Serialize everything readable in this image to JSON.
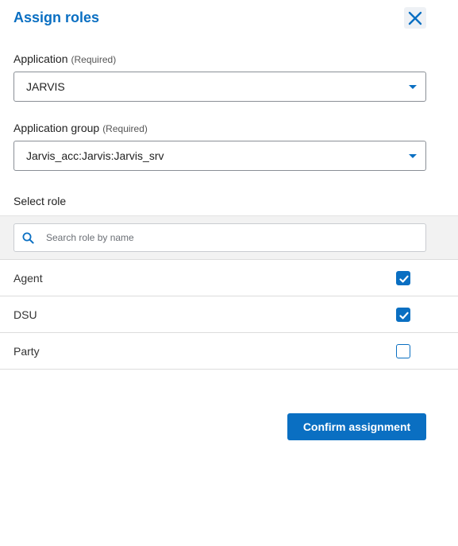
{
  "dialog": {
    "title": "Assign roles",
    "close_icon": "close-icon"
  },
  "application": {
    "label": "Application",
    "required": "(Required)",
    "value": "JARVIS"
  },
  "application_group": {
    "label": "Application group",
    "required": "(Required)",
    "value": "Jarvis_acc:Jarvis:Jarvis_srv"
  },
  "roles": {
    "label": "Select role",
    "search_placeholder": "Search role by name",
    "items": [
      {
        "name": "Agent",
        "checked": true
      },
      {
        "name": "DSU",
        "checked": true
      },
      {
        "name": "Party",
        "checked": false
      }
    ]
  },
  "actions": {
    "confirm_label": "Confirm assignment"
  },
  "colors": {
    "accent": "#0a6fc2",
    "band": "#f2f2f2"
  }
}
